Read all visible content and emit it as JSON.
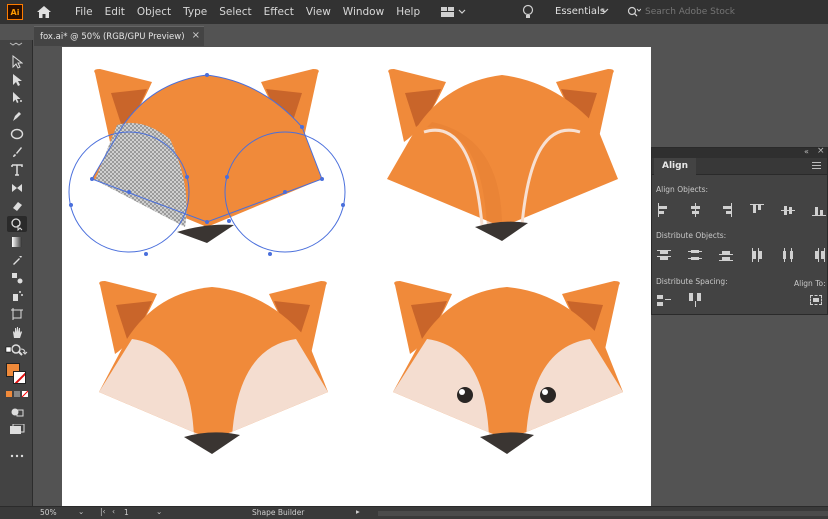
{
  "app": {
    "logo_text": "Ai"
  },
  "menu": [
    "File",
    "Edit",
    "Object",
    "Type",
    "Select",
    "Effect",
    "View",
    "Window",
    "Help"
  ],
  "workspace": {
    "name": "Essentials"
  },
  "search": {
    "placeholder": "Search Adobe Stock"
  },
  "document_tab": {
    "title": "fox.ai* @ 50% (RGB/GPU Preview)",
    "close": "×"
  },
  "align_panel": {
    "title": "Align",
    "align_objects_label": "Align Objects:",
    "distribute_objects_label": "Distribute Objects:",
    "distribute_spacing_label": "Distribute Spacing:",
    "align_to_label": "Align To:"
  },
  "status": {
    "zoom": "50%",
    "artboard_number": "1",
    "tool_name": "Shape Builder"
  },
  "colors": {
    "fox_orange": "#f08a3a",
    "fox_dark_orange": "#d9692a",
    "ear_inner": "#c9652a",
    "cheek": "#f4ddd0",
    "nose": "#3a3532",
    "path_blue": "#4a6fdc",
    "ui_bg": "#535353"
  },
  "tools": [
    "selection-tool-icon",
    "direct-selection-tool-icon",
    "pen-tool-icon",
    "curvature-tool-icon",
    "ellipse-tool-icon",
    "paintbrush-tool-icon",
    "type-tool-icon",
    "width-tool-icon",
    "eraser-tool-icon",
    "shape-builder-tool-icon",
    "gradient-tool-icon",
    "eyedropper-tool-icon",
    "blend-tool-icon",
    "symbol-sprayer-tool-icon",
    "artboard-tool-icon",
    "hand-tool-icon",
    "zoom-tool-icon"
  ]
}
